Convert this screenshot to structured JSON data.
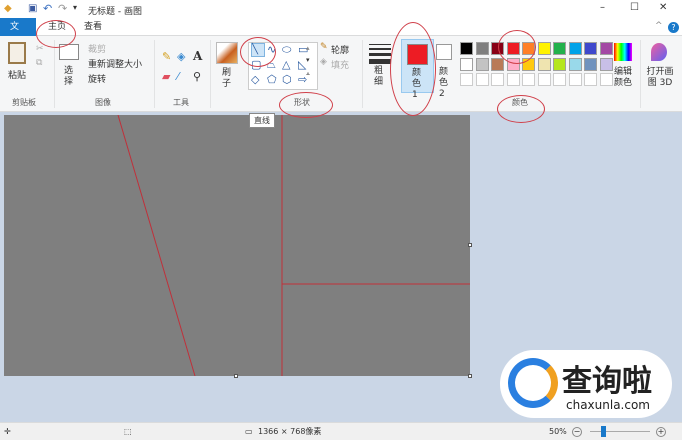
{
  "window": {
    "title": "无标题 - 画图",
    "minimize": "–",
    "maximize": "☐",
    "close": "✕",
    "help": "?",
    "collapse": "^"
  },
  "tabs": [
    {
      "label": "文件"
    },
    {
      "label": "主页"
    },
    {
      "label": "查看"
    }
  ],
  "clipboard": {
    "paste": "粘贴",
    "group": "剪贴板"
  },
  "image": {
    "select": "选择",
    "crop": "裁剪",
    "resize": "重新调整大小",
    "rotate": "旋转",
    "group": "图像"
  },
  "tools": {
    "group": "工具"
  },
  "brush": {
    "label": "刷子"
  },
  "shapes": {
    "outline": "轮廓",
    "fill": "填充",
    "group": "形状",
    "tooltip": "直线"
  },
  "size": {
    "label": "粗细"
  },
  "colors": {
    "color1": "颜色 1",
    "color2": "颜色 2",
    "edit": "编辑颜色",
    "group": "颜色",
    "active": "#ed1c24",
    "palette": [
      [
        "#000000",
        "#7f7f7f",
        "#880015",
        "#ed1c24",
        "#ff7f27",
        "#fff200",
        "#22b14c",
        "#00a2e8",
        "#3f48cc",
        "#a349a4"
      ],
      [
        "#ffffff",
        "#c3c3c3",
        "#b97a57",
        "#ffaec9",
        "#ffc90e",
        "#efe4b0",
        "#b5e61d",
        "#99d9ea",
        "#7092be",
        "#c8bfe7"
      ]
    ]
  },
  "paint3d": {
    "label": "打开画图 3D"
  },
  "status": {
    "dimensions": "1366 × 768像素",
    "zoom": "50%"
  },
  "watermark": {
    "brand": "查询啦",
    "url": "chaxunla.com"
  }
}
